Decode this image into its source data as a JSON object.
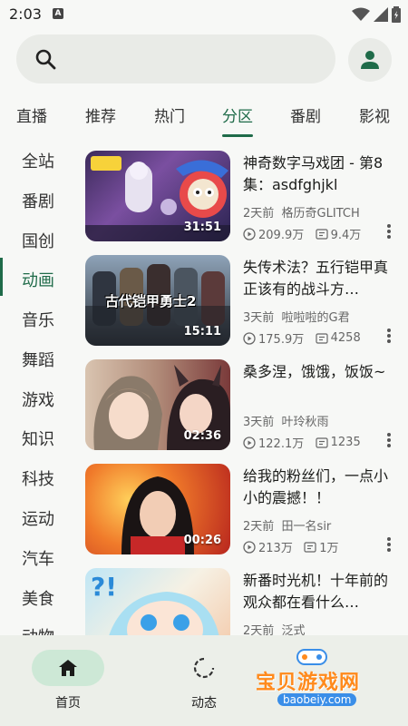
{
  "status_bar": {
    "time": "2:03",
    "notification_letter": "A"
  },
  "search": {
    "placeholder": ""
  },
  "tabs": [
    {
      "label": "直播",
      "active": false
    },
    {
      "label": "推荐",
      "active": false
    },
    {
      "label": "热门",
      "active": false
    },
    {
      "label": "分区",
      "active": true
    },
    {
      "label": "番剧",
      "active": false
    },
    {
      "label": "影视",
      "active": false
    }
  ],
  "sidebar": [
    {
      "label": "全站"
    },
    {
      "label": "番剧"
    },
    {
      "label": "国创"
    },
    {
      "label": "动画",
      "active": true
    },
    {
      "label": "音乐"
    },
    {
      "label": "舞蹈"
    },
    {
      "label": "游戏"
    },
    {
      "label": "知识"
    },
    {
      "label": "科技"
    },
    {
      "label": "运动"
    },
    {
      "label": "汽车"
    },
    {
      "label": "美食"
    },
    {
      "label": "动物"
    }
  ],
  "videos": [
    {
      "title": "神奇数字马戏团 - 第8集：asdfghjkl",
      "duration": "31:51",
      "time_ago": "2天前",
      "author": "格历奇GLITCH",
      "views": "209.9万",
      "comments": "9.4万"
    },
    {
      "title": "失传术法？五行铠甲真正该有的战斗方…",
      "duration": "15:11",
      "time_ago": "3天前",
      "author": "啦啦啦的G君",
      "views": "175.9万",
      "comments": "4258"
    },
    {
      "title": "桑多涅，饿饿，饭饭~",
      "duration": "02:36",
      "time_ago": "3天前",
      "author": "叶玲秋雨",
      "views": "122.1万",
      "comments": "1235"
    },
    {
      "title": "给我的粉丝们，一点小小的震撼！！",
      "duration": "00:26",
      "time_ago": "2天前",
      "author": "田一名sir",
      "views": "213万",
      "comments": "1万"
    },
    {
      "title": "新番时光机！十年前的观众都在看什么…",
      "duration": "",
      "time_ago": "2天前",
      "author": "泛式",
      "views": "",
      "comments": ""
    }
  ],
  "thumb_overlay_text": {
    "armor": "古代铠甲勇士2"
  },
  "bottom_nav": [
    {
      "label": "首页",
      "icon": "home-icon",
      "active": true
    },
    {
      "label": "动态",
      "icon": "refresh-icon",
      "active": false
    }
  ],
  "watermark": {
    "title": "宝贝游戏网",
    "url": "baobeiy.com"
  },
  "colors": {
    "accent": "#1f6b49",
    "pill": "#cde8d6",
    "background": "#f7f8f6"
  }
}
